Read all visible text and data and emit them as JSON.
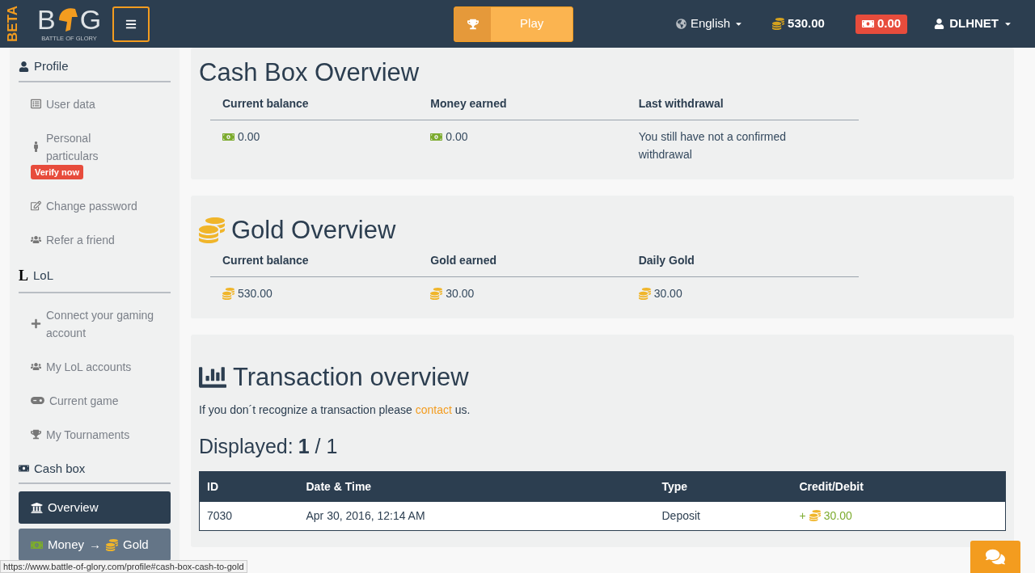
{
  "header": {
    "beta": "BETA",
    "logo_left": "B",
    "logo_right": "G",
    "logo_tagline": "BATTLE OF GLORY",
    "play": "Play",
    "language": "English",
    "gold": "530.00",
    "cash": "0.00",
    "user": "DLHNET"
  },
  "sidebar": [
    {
      "title": "Profile",
      "kind": "links",
      "items": [
        {
          "label": "User data"
        },
        {
          "label": "Personal particulars",
          "badge": "Verify now"
        },
        {
          "label": "Change password"
        },
        {
          "label": "Refer a friend"
        }
      ]
    },
    {
      "title": "LoL",
      "icon_char": "L",
      "kind": "links",
      "items": [
        {
          "label": "Connect your gaming account"
        },
        {
          "label": "My LoL accounts"
        },
        {
          "label": "Current game"
        },
        {
          "label": "My Tournaments"
        }
      ]
    },
    {
      "title": "Cash box",
      "kind": "buttons",
      "items": [
        {
          "label": "Overview",
          "selected": true
        },
        {
          "label": "Money",
          "arrow": "→",
          "target": "Gold",
          "selected": false
        }
      ]
    }
  ],
  "cash_box": {
    "title": "Cash Box Overview",
    "columns": [
      "Current balance",
      "Money earned",
      "Last withdrawal"
    ],
    "values": [
      {
        "text": "0.00",
        "kind": "money"
      },
      {
        "text": "0.00",
        "kind": "money"
      },
      {
        "text": "You still have not a confirmed withdrawal",
        "kind": "text"
      }
    ]
  },
  "gold": {
    "title": "Gold Overview",
    "columns": [
      "Current balance",
      "Gold earned",
      "Daily Gold"
    ],
    "values": [
      {
        "text": "530.00",
        "kind": "gold"
      },
      {
        "text": "30.00",
        "kind": "gold"
      },
      {
        "text": "30.00",
        "kind": "gold"
      }
    ]
  },
  "transactions": {
    "title": "Transaction overview",
    "note_before": "If you don´t recognize a transaction please",
    "note_link": "contact",
    "note_after": "us.",
    "displayed_label": "Displayed:",
    "displayed_value": "**1** / 1",
    "columns": [
      "ID",
      "Date & Time",
      "Type",
      "Credit/Debit"
    ],
    "rows": [
      {
        "id": "7030",
        "date": "Apr 30, 2016, 12:14 AM",
        "type": "Deposit",
        "sign": "+",
        "amount": "30.00"
      }
    ]
  },
  "status_url": "https://www.battle-of-glory.com/profile#cash-box-cash-to-gold"
}
